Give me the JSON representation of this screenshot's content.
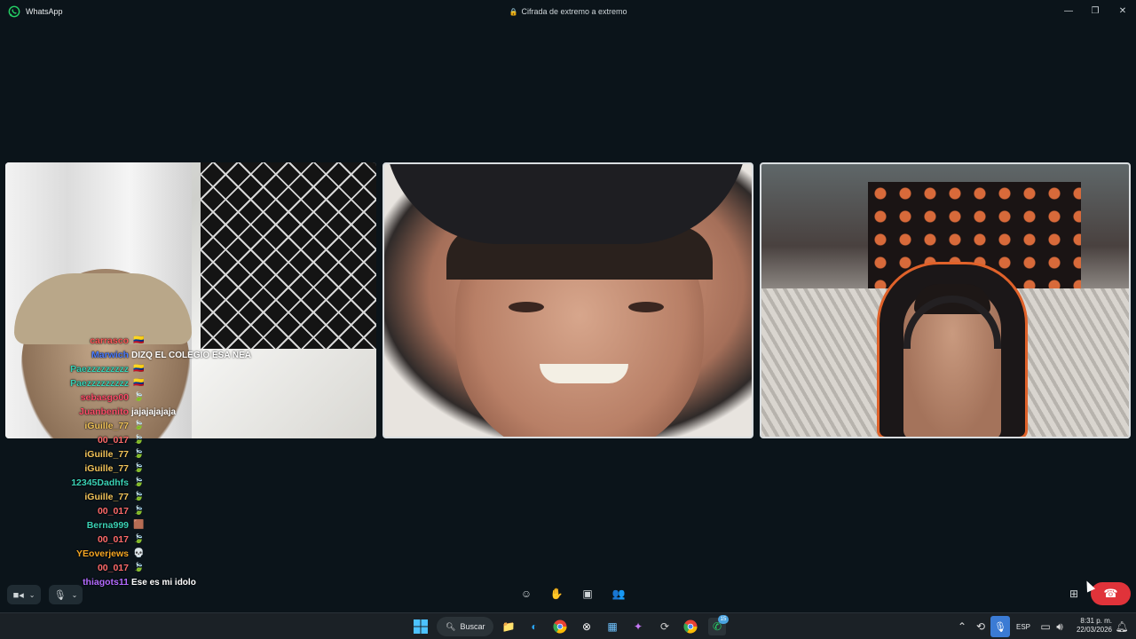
{
  "titlebar": {
    "app_name": "WhatsApp",
    "encryption_text": "Cifrada de extremo a extremo",
    "minimize_icon": "minimize-icon",
    "maximize_icon": "restore-icon",
    "close_icon": "close-icon"
  },
  "chat": [
    {
      "user": "carrasco",
      "color": "#ff5a5a",
      "badge": "flag",
      "message": ""
    },
    {
      "user": "Marwich",
      "color": "#4b7bff",
      "badge": "",
      "message": "DIZQ EL COLEGIO ESA NEA"
    },
    {
      "user": "Paezzzzzzzzz",
      "color": "#3ad1b5",
      "badge": "flag",
      "message": ""
    },
    {
      "user": "Paezzzzzzzzz",
      "color": "#3ad1b5",
      "badge": "flag",
      "message": ""
    },
    {
      "user": "sebasgo00",
      "color": "#ff4f6a",
      "badge": "leaf",
      "message": ""
    },
    {
      "user": "Juanbenito",
      "color": "#ff4f6a",
      "badge": "",
      "message": "jajajajajaja"
    },
    {
      "user": "iGuille_77",
      "color": "#f2c45a",
      "badge": "leaf",
      "message": ""
    },
    {
      "user": "00_017",
      "color": "#ff6b6b",
      "badge": "leaf",
      "message": ""
    },
    {
      "user": "iGuille_77",
      "color": "#f2c45a",
      "badge": "leaf",
      "message": ""
    },
    {
      "user": "iGuille_77",
      "color": "#f2c45a",
      "badge": "leaf",
      "message": ""
    },
    {
      "user": "12345Dadhfs",
      "color": "#3ad1b5",
      "badge": "leaf",
      "message": ""
    },
    {
      "user": "iGuille_77",
      "color": "#f2c45a",
      "badge": "leaf",
      "message": ""
    },
    {
      "user": "00_017",
      "color": "#ff6b6b",
      "badge": "leaf",
      "message": ""
    },
    {
      "user": "Berna999",
      "color": "#3ad1b5",
      "badge": "emote",
      "message": ""
    },
    {
      "user": "00_017",
      "color": "#ff6b6b",
      "badge": "leaf",
      "message": ""
    },
    {
      "user": "YEoverjews",
      "color": "#f5a623",
      "badge": "skull",
      "message": ""
    },
    {
      "user": "00_017",
      "color": "#ff6b6b",
      "badge": "leaf",
      "message": ""
    },
    {
      "user": "thiagots11",
      "color": "#b36bff",
      "badge": "",
      "message": "Ese es mi idolo"
    }
  ],
  "controls": {
    "camera_icon": "camera-icon",
    "mic_icon": "microphone-icon",
    "emoji_icon": "emoji-icon",
    "raise_hand_icon": "raise-hand-icon",
    "share_screen_icon": "share-screen-icon",
    "participants_icon": "participants-icon",
    "layout_icon": "layout-icon",
    "end_call_icon": "end-call-icon"
  },
  "taskbar": {
    "search_label": "Buscar",
    "language": "ESP",
    "time": "8:31 p. m.",
    "date": "22/03/2026",
    "whatsapp_badge": "15"
  },
  "colors": {
    "background": "#0b141a",
    "end_call": "#e0333a",
    "tile_border": "#d9dde0"
  }
}
